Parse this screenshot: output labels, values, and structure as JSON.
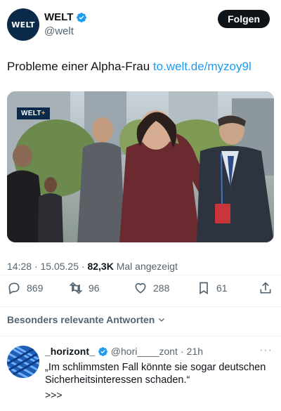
{
  "account": {
    "avatar_text": "WELT",
    "display_name": "WELT",
    "handle": "@welt",
    "follow_label": "Folgen"
  },
  "tweet": {
    "text": "Probleme einer Alpha-Frau",
    "link": "to.welt.de/myzoy9l",
    "media_badge": "WELT",
    "media_badge_plus": "+"
  },
  "meta": {
    "time": "14:28",
    "separator": "·",
    "date": "15.05.25",
    "views_count": "82,3K",
    "views_label": "Mal angezeigt"
  },
  "actions": {
    "replies": "869",
    "retweets": "96",
    "likes": "288",
    "bookmarks": "61"
  },
  "replies_filter": {
    "label": "Besonders relevante Antworten"
  },
  "reply": {
    "name": "_horizont_",
    "handle": "@hori____zont",
    "time": "21h",
    "text": "„Im schlimmsten Fall könnte sie sogar deutschen Sicherheitsinteressen schaden.“",
    "more": ">>>"
  },
  "colors": {
    "brand_navy": "#0b2a4a",
    "link_blue": "#1d9bf0",
    "verified_blue": "#1d9bf0",
    "muted": "#536471"
  }
}
